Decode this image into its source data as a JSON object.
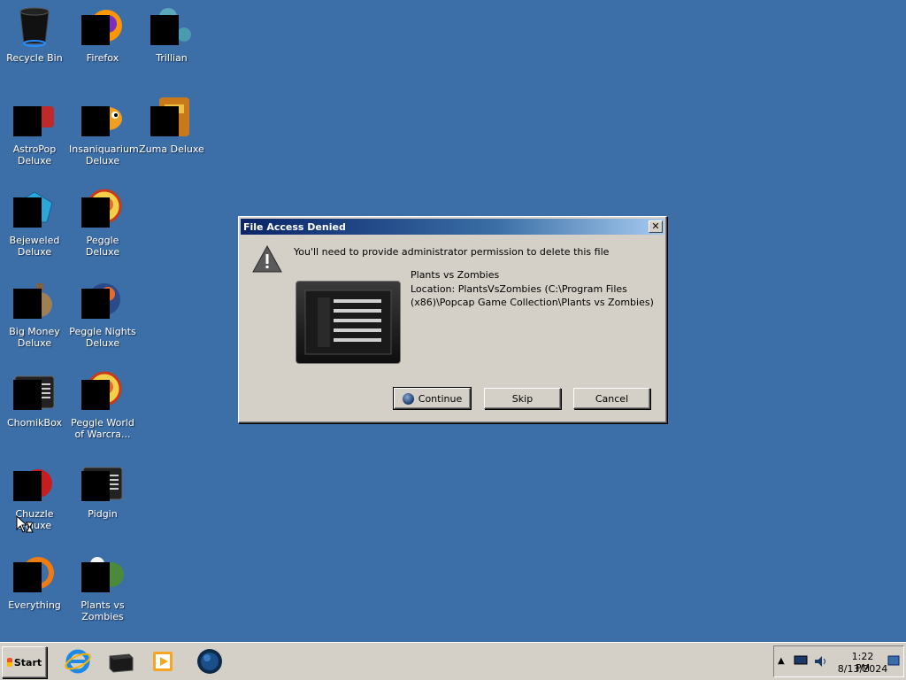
{
  "desktop": {
    "icons": [
      {
        "id": "recycle-bin",
        "label": "Recycle Bin"
      },
      {
        "id": "firefox",
        "label": "Firefox"
      },
      {
        "id": "trillian",
        "label": "Trillian"
      },
      {
        "id": "astropop",
        "label": "AstroPop Deluxe"
      },
      {
        "id": "insaniquarium",
        "label": "Insaniquarium Deluxe"
      },
      {
        "id": "zuma",
        "label": "Zuma Deluxe"
      },
      {
        "id": "bejeweled",
        "label": "Bejeweled Deluxe"
      },
      {
        "id": "peggle",
        "label": "Peggle Deluxe"
      },
      {
        "id": "big-money",
        "label": "Big Money Deluxe"
      },
      {
        "id": "peggle-nights",
        "label": "Peggle Nights Deluxe"
      },
      {
        "id": "chomikbox",
        "label": "ChomikBox"
      },
      {
        "id": "peggle-world",
        "label": "Peggle World of Warcra..."
      },
      {
        "id": "chuzzle",
        "label": "Chuzzle Deluxe"
      },
      {
        "id": "pidgin",
        "label": "Pidgin"
      },
      {
        "id": "everything",
        "label": "Everything"
      },
      {
        "id": "plants-vs-zombies",
        "label": "Plants vs Zombies"
      }
    ]
  },
  "dialog": {
    "title": "File Access Denied",
    "close_glyph": "✕",
    "message": "You'll need to provide administrator permission to delete this file",
    "file_name": "Plants vs Zombies",
    "file_location": "Location: PlantsVsZombies (C:\\Program Files (x86)\\Popcap Game Collection\\Plants vs Zombies)",
    "buttons": {
      "continue": "Continue",
      "skip": "Skip",
      "cancel": "Cancel"
    }
  },
  "taskbar": {
    "start_label": "Start",
    "pinned": [
      "internet-explorer-icon",
      "explorer-icon",
      "media-player-icon",
      "network-globe-icon"
    ],
    "tray": {
      "icons": [
        "show-hidden-icons-chevron",
        "display-icon",
        "volume-icon",
        "show-desktop-icon"
      ],
      "time": "1:22 PM",
      "date": "8/13/2024"
    }
  },
  "colors": {
    "desktop_bg": "#3c6ea8",
    "dialog_bg": "#d4d0c8",
    "titlebar_start": "#0a246a",
    "titlebar_end": "#a6caf0"
  }
}
